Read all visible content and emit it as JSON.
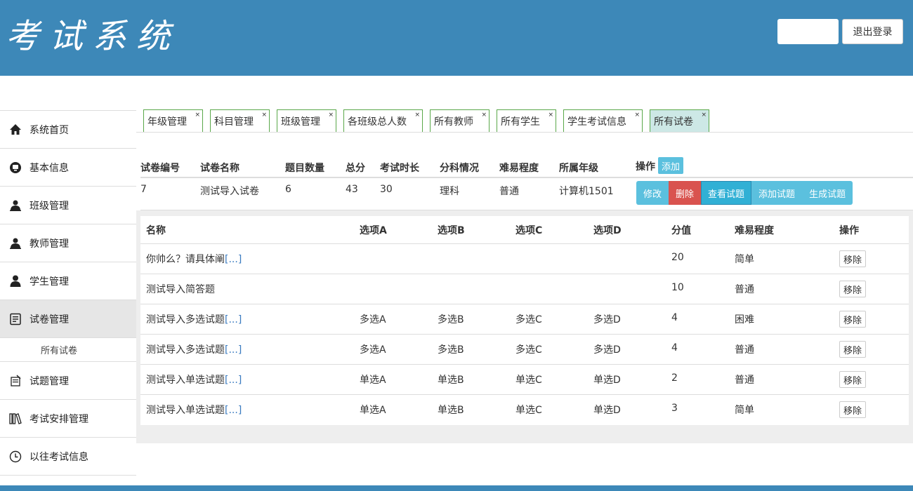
{
  "header": {
    "logo": "考试系统",
    "logout": "退出登录"
  },
  "sidebar": {
    "items": [
      {
        "label": "系统首页",
        "icon": "home-icon"
      },
      {
        "label": "基本信息",
        "icon": "info-icon"
      },
      {
        "label": "班级管理",
        "icon": "user-icon"
      },
      {
        "label": "教师管理",
        "icon": "user-icon"
      },
      {
        "label": "学生管理",
        "icon": "student-icon"
      },
      {
        "label": "试卷管理",
        "icon": "paper-icon"
      },
      {
        "label": "试题管理",
        "icon": "question-icon"
      },
      {
        "label": "考试安排管理",
        "icon": "books-icon"
      },
      {
        "label": "以往考试信息",
        "icon": "clock-icon"
      }
    ],
    "sub_item": "所有试卷"
  },
  "tabs": [
    "年级管理",
    "科目管理",
    "班级管理",
    "各班级总人数",
    "所有教师",
    "所有学生",
    "学生考试信息",
    "所有试卷"
  ],
  "tab_close": "×",
  "paper_table": {
    "headers": [
      "试卷编号",
      "试卷名称",
      "题目数量",
      "总分",
      "考试时长",
      "分科情况",
      "难易程度",
      "所属年级",
      "操作"
    ],
    "add_label": "添加",
    "row": [
      "7",
      "测试导入试卷",
      "6",
      "43",
      "30",
      "理科",
      "普通",
      "计算机1501"
    ],
    "ops": [
      "修改",
      "删除",
      "查看试题",
      "添加试题",
      "生成试题"
    ]
  },
  "question_table": {
    "headers": [
      "名称",
      "选项A",
      "选项B",
      "选项C",
      "选项D",
      "分值",
      "难易程度",
      "操作"
    ],
    "more": "[...]",
    "remove_label": "移除",
    "rows": [
      {
        "name": "你帅么？请具体阐",
        "more": true,
        "a": "",
        "b": "",
        "c": "",
        "d": "",
        "score": "20",
        "level": "简单"
      },
      {
        "name": "测试导入简答题",
        "more": false,
        "a": "",
        "b": "",
        "c": "",
        "d": "",
        "score": "10",
        "level": "普通"
      },
      {
        "name": "测试导入多选试题",
        "more": true,
        "a": "多选A",
        "b": "多选B",
        "c": "多选C",
        "d": "多选D",
        "score": "4",
        "level": "困难"
      },
      {
        "name": "测试导入多选试题",
        "more": true,
        "a": "多选A",
        "b": "多选B",
        "c": "多选C",
        "d": "多选D",
        "score": "4",
        "level": "普通"
      },
      {
        "name": "测试导入单选试题",
        "more": true,
        "a": "单选A",
        "b": "单选B",
        "c": "单选C",
        "d": "单选D",
        "score": "2",
        "level": "普通"
      },
      {
        "name": "测试导入单选试题",
        "more": true,
        "a": "单选A",
        "b": "单选B",
        "c": "单选C",
        "d": "单选D",
        "score": "3",
        "level": "简单"
      }
    ]
  },
  "colors": {
    "header": "#3d88b8",
    "info": "#5bc0de",
    "danger": "#d9534f",
    "tab_border": "#5aa84a",
    "tab_active": "#cde8e6"
  }
}
